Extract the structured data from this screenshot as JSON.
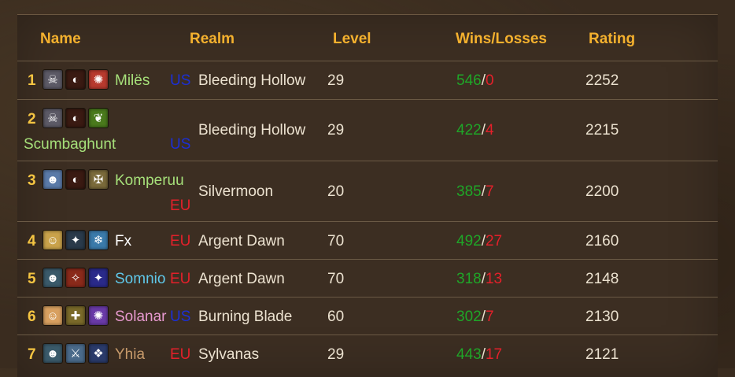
{
  "headers": {
    "name": "Name",
    "realm": "Realm",
    "level": "Level",
    "winslosses": "Wins/Losses",
    "rating": "Rating"
  },
  "rows": [
    {
      "rank": "1",
      "name": "Milës",
      "name_color": "#a6e07a",
      "region": "US",
      "realm": "Bleeding Hollow",
      "level": "29",
      "wins": "546",
      "losses": "0",
      "rating": "2252",
      "icons": [
        {
          "name": "undead-race-icon",
          "color": "#5c5a66",
          "glyph": "☠"
        },
        {
          "name": "warlock-class-icon",
          "color": "#3a1a12",
          "glyph": "◐"
        },
        {
          "name": "specialization-icon",
          "color": "#b83a2e",
          "glyph": "✺"
        }
      ]
    },
    {
      "rank": "2",
      "name": "Scumbaghunt",
      "name_color": "#a6e07a",
      "region": "US",
      "realm": "Bleeding Hollow",
      "level": "29",
      "wins": "422",
      "losses": "4",
      "rating": "2215",
      "icons": [
        {
          "name": "undead-race-icon",
          "color": "#5c5a66",
          "glyph": "☠"
        },
        {
          "name": "hunter-class-icon",
          "color": "#3a1a12",
          "glyph": "◐"
        },
        {
          "name": "specialization-icon",
          "color": "#4a7a1c",
          "glyph": "❦"
        }
      ]
    },
    {
      "rank": "3",
      "name": "Komperuu",
      "name_color": "#a6e07a",
      "region": "EU",
      "realm": "Silvermoon",
      "level": "20",
      "wins": "385",
      "losses": "7",
      "rating": "2200",
      "icons": [
        {
          "name": "draenei-race-icon",
          "color": "#5a7aa8",
          "glyph": "☻"
        },
        {
          "name": "hunter-class-icon",
          "color": "#3a1a12",
          "glyph": "◐"
        },
        {
          "name": "specialization-icon",
          "color": "#7a6a3a",
          "glyph": "✠"
        }
      ]
    },
    {
      "rank": "4",
      "name": "Fx",
      "name_color": "#ffffff",
      "region": "EU",
      "realm": "Argent Dawn",
      "level": "70",
      "wins": "492",
      "losses": "27",
      "rating": "2160",
      "icons": [
        {
          "name": "human-race-icon",
          "color": "#c9a24a",
          "glyph": "☺"
        },
        {
          "name": "priest-class-icon",
          "color": "#2a3a4a",
          "glyph": "✦"
        },
        {
          "name": "specialization-icon",
          "color": "#3a7aaa",
          "glyph": "❄"
        }
      ]
    },
    {
      "rank": "5",
      "name": "Somnio",
      "name_color": "#5fc8ea",
      "region": "EU",
      "realm": "Argent Dawn",
      "level": "70",
      "wins": "318",
      "losses": "13",
      "rating": "2148",
      "icons": [
        {
          "name": "night-elf-race-icon",
          "color": "#3a5a6a",
          "glyph": "☻"
        },
        {
          "name": "mage-class-icon",
          "color": "#8a2a1a",
          "glyph": "✧"
        },
        {
          "name": "specialization-icon",
          "color": "#2a2a8a",
          "glyph": "✦"
        }
      ]
    },
    {
      "rank": "6",
      "name": "Solanar",
      "name_color": "#e89ad0",
      "region": "US",
      "realm": "Burning Blade",
      "level": "60",
      "wins": "302",
      "losses": "7",
      "rating": "2130",
      "icons": [
        {
          "name": "blood-elf-race-icon",
          "color": "#d8a060",
          "glyph": "☺"
        },
        {
          "name": "paladin-class-icon",
          "color": "#7a6a2a",
          "glyph": "✚"
        },
        {
          "name": "specialization-icon",
          "color": "#6a3aa8",
          "glyph": "✺"
        }
      ]
    },
    {
      "rank": "7",
      "name": "Yhia",
      "name_color": "#c89b6b",
      "region": "EU",
      "realm": "Sylvanas",
      "level": "29",
      "wins": "443",
      "losses": "17",
      "rating": "2121",
      "icons": [
        {
          "name": "night-elf-race-icon",
          "color": "#3a5a6a",
          "glyph": "☻"
        },
        {
          "name": "warrior-class-icon",
          "color": "#4a6a8a",
          "glyph": "⚔"
        },
        {
          "name": "specialization-icon",
          "color": "#2a3a6a",
          "glyph": "❖"
        }
      ]
    }
  ]
}
